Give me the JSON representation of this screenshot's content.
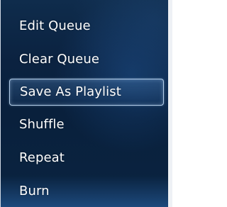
{
  "menu": {
    "items": [
      {
        "label": "Edit Queue"
      },
      {
        "label": "Clear Queue"
      },
      {
        "label": "Save As Playlist"
      },
      {
        "label": "Shuffle"
      },
      {
        "label": "Repeat"
      },
      {
        "label": "Burn"
      }
    ],
    "selected_label": "Save As Playlist"
  },
  "colors": {
    "background": "#0b2240",
    "text": "#ffffff",
    "selection_border": "#bed7f0"
  }
}
